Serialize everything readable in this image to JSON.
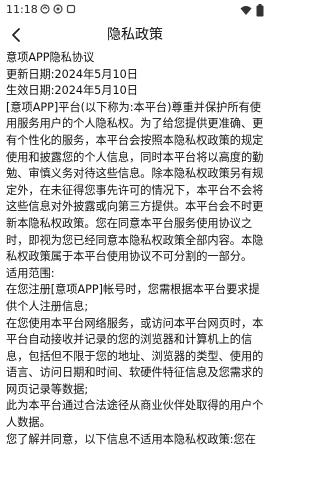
{
  "status_bar": {
    "time": "11:18"
  },
  "header": {
    "title": "隐私政策"
  },
  "policy": {
    "paragraphs": [
      "意项APP隐私协议",
      "更新日期:2024年5月10日",
      "生效日期:2024年5月10日",
      "[意项APP]平台(以下称为:本平台)尊重并保护所有使用服务用户的个人隐私权。为了给您提供更准确、更有个性化的服务，本平台会按照本隐私权政策的规定使用和披露您的个人信息，同时本平台将以高度的勤勉、审慎义务对待这些信息。除本隐私权政策另有规定外，在未征得您事先许可的情况下，本平台不会将这些信息对外披露或向第三方提供。本平台会不时更新本隐私权政策。您在同意本平台服务使用协议之时，即视为您已经同意本隐私权政策全部内容。本隐私权政策属于本平台使用协议不可分割的一部分。",
      "适用范围:",
      "在您注册[意项APP]帐号时，您需根据本平台要求提供个人注册信息;",
      "在您使用本平台网络服务，或访问本平台网页时，本平台自动接收并记录的您的浏览器和计算机上的信息，包括但不限于您的地址、浏览器的类型、使用的语言、访问日期和时间、软硬件特征信息及您需求的网页记录等数据;",
      "此为本平台通过合法途径从商业伙伴处取得的用户个人数据。",
      "您了解并同意，以下信息不适用本隐私权政策:您在"
    ]
  }
}
